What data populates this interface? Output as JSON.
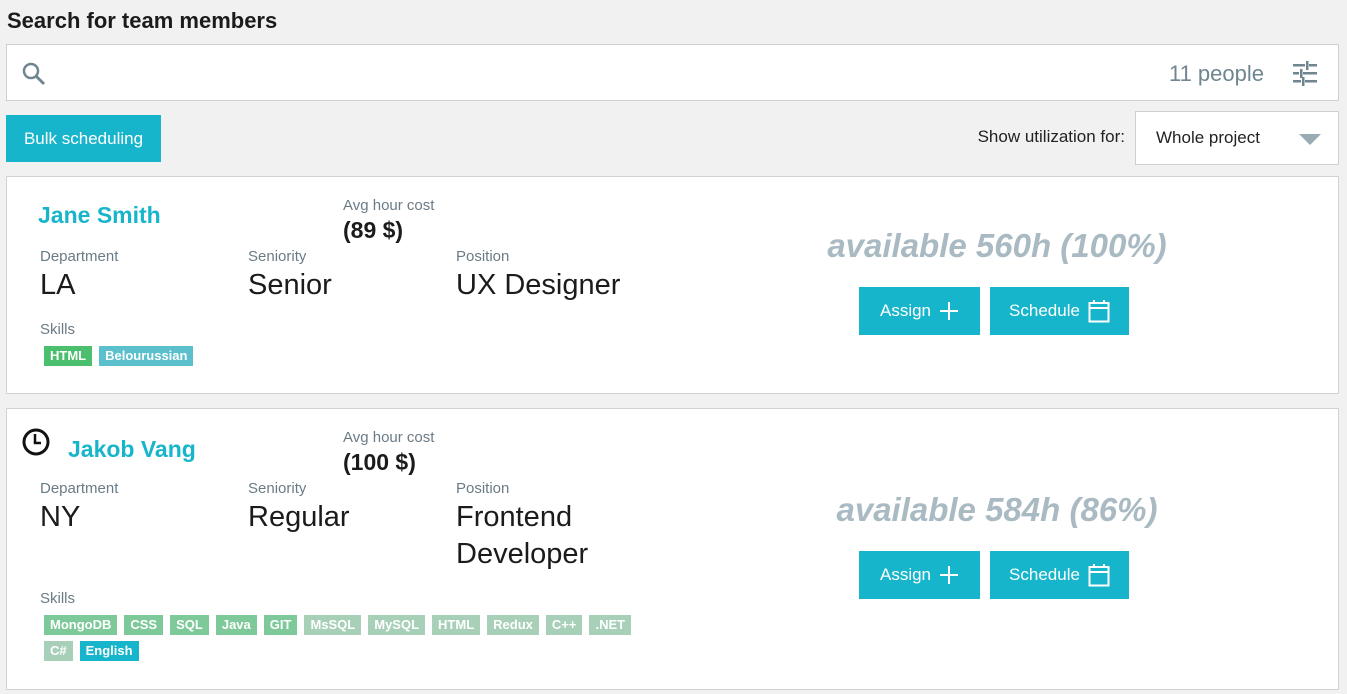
{
  "header": {
    "title": "Search for team members"
  },
  "search": {
    "value": "",
    "placeholder": "",
    "count_label": "11 people",
    "search_icon": "search-icon",
    "filter_icon": "sliders-icon"
  },
  "toolbar": {
    "bulk_scheduling_label": "Bulk scheduling",
    "utilization_label": "Show utilization for:",
    "utilization_selected": "Whole project"
  },
  "labels": {
    "avg_hour_cost": "Avg hour cost",
    "department": "Department",
    "seniority": "Seniority",
    "position": "Position",
    "skills": "Skills",
    "assign": "Assign",
    "schedule": "Schedule"
  },
  "colors": {
    "accent": "#17b5cb",
    "skill_primary": "#4cbf6e",
    "skill_match": "#7ec99a",
    "skill_partial": "#a8d0b8",
    "language": "#5bc0cc",
    "availability_text": "#a9bac3"
  },
  "members": [
    {
      "name": "Jane Smith",
      "has_clock_icon": false,
      "avg_hour_cost": "(89 $)",
      "department": "LA",
      "seniority": "Senior",
      "position": "UX Designer",
      "availability": "available 560h (100%)",
      "available_hours": 560,
      "available_percent": 100,
      "skills": [
        {
          "label": "HTML",
          "color": "#4cbf6e"
        },
        {
          "label": "Belourussian",
          "color": "#5bc0cc"
        }
      ]
    },
    {
      "name": "Jakob Vang",
      "has_clock_icon": true,
      "avg_hour_cost": "(100 $)",
      "department": "NY",
      "seniority": "Regular",
      "position": "Frontend Developer",
      "availability": "available 584h (86%)",
      "available_hours": 584,
      "available_percent": 86,
      "skills": [
        {
          "label": "MongoDB",
          "color": "#7ec99a"
        },
        {
          "label": "CSS",
          "color": "#7ec99a"
        },
        {
          "label": "SQL",
          "color": "#7ec99a"
        },
        {
          "label": "Java",
          "color": "#7ec99a"
        },
        {
          "label": "GIT",
          "color": "#7ec99a"
        },
        {
          "label": "MsSQL",
          "color": "#a8d0b8"
        },
        {
          "label": "MySQL",
          "color": "#a8d0b8"
        },
        {
          "label": "HTML",
          "color": "#a8d0b8"
        },
        {
          "label": "Redux",
          "color": "#a8d0b8"
        },
        {
          "label": "C++",
          "color": "#a8d0b8"
        },
        {
          "label": ".NET",
          "color": "#a8d0b8"
        },
        {
          "label": "C#",
          "color": "#a8d0b8"
        },
        {
          "label": "English",
          "color": "#17b5cb"
        }
      ]
    }
  ]
}
